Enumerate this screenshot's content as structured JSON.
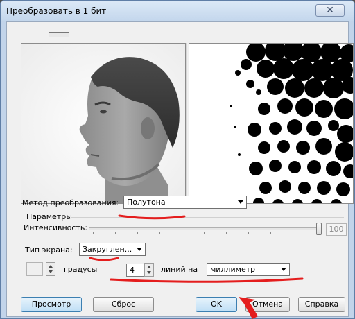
{
  "window": {
    "title": "Преобразовать в 1 бит",
    "close_label": "✕"
  },
  "conversion": {
    "label": "Метод преобразования:",
    "value": "Полутона"
  },
  "parameters": {
    "group_label": "Параметры",
    "intensity_label": "Интенсивность:",
    "intensity_value": "100",
    "intensity_fraction": 1.0
  },
  "screen": {
    "label": "Тип экрана:",
    "value": "Закруглен..."
  },
  "angle": {
    "label": "градусы"
  },
  "lines": {
    "value": "4",
    "label": "линий на",
    "unit": "миллиметр"
  },
  "buttons": {
    "preview": "Просмотр",
    "reset": "Сброс",
    "ok": "OK",
    "cancel": "Отмена",
    "help": "Справка"
  },
  "colors": {
    "annotation": "#e41d1d",
    "default_button": "#3c7fb1"
  }
}
